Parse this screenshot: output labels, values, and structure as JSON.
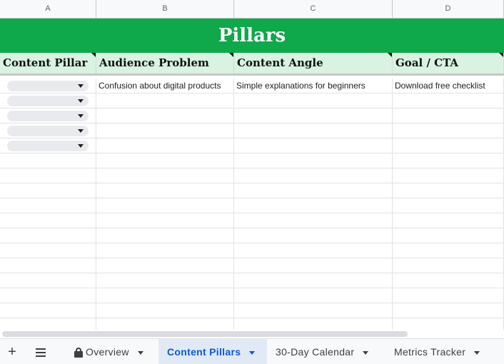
{
  "columns": [
    "A",
    "B",
    "C",
    "D"
  ],
  "title": "Pillars",
  "headers": [
    "Content Pillar",
    "Audience Problem",
    "Content Angle",
    "Goal / CTA"
  ],
  "rows": [
    {
      "b": "Confusion about digital products",
      "c": "Simple explanations for beginners",
      "d": "Download free checklist"
    }
  ],
  "tabs": {
    "add_icon": "plus-icon",
    "menu_icon": "hamburger-icon",
    "items": [
      {
        "label": "Overview",
        "locked": true
      },
      {
        "label": "Content Pillars",
        "active": true
      },
      {
        "label": "30-Day Calendar"
      },
      {
        "label": "Metrics Tracker"
      }
    ]
  },
  "colors": {
    "title_bg": "#0fa84a",
    "header_bg": "#d9f2e1",
    "active_tab": "#0b57d0"
  }
}
